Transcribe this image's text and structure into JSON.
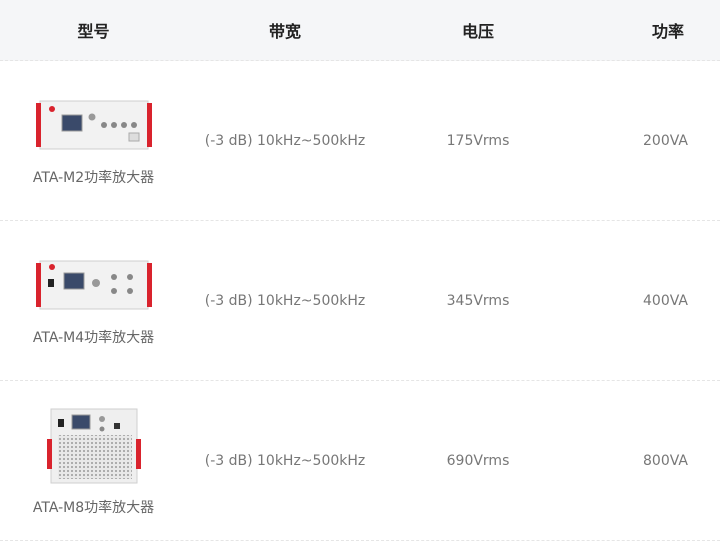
{
  "header": {
    "col_model": "型号",
    "col_bandwidth": "带宽",
    "col_voltage": "电压",
    "col_power": "功率"
  },
  "rows": [
    {
      "model": "ATA-M2功率放大器",
      "bandwidth": "(-3 dB)  10kHz~500kHz",
      "voltage": "175Vrms",
      "power": "200VA"
    },
    {
      "model": "ATA-M4功率放大器",
      "bandwidth": "(-3 dB)  10kHz~500kHz",
      "voltage": "345Vrms",
      "power": "400VA"
    },
    {
      "model": "ATA-M8功率放大器",
      "bandwidth": "(-3 dB)  10kHz~500kHz",
      "voltage": "690Vrms",
      "power": "800VA"
    }
  ],
  "colors": {
    "accent_red": "#d9232d",
    "header_bg": "#f5f6f8"
  }
}
